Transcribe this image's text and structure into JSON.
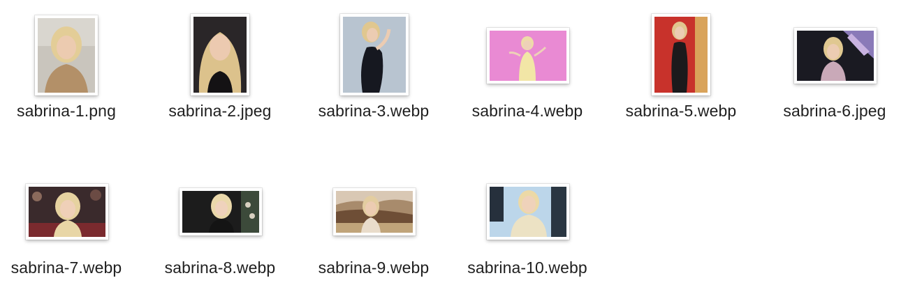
{
  "files": [
    {
      "name": "sabrina-1.png"
    },
    {
      "name": "sabrina-2.jpeg"
    },
    {
      "name": "sabrina-3.webp"
    },
    {
      "name": "sabrina-4.webp"
    },
    {
      "name": "sabrina-5.webp"
    },
    {
      "name": "sabrina-6.jpeg"
    },
    {
      "name": "sabrina-7.webp"
    },
    {
      "name": "sabrina-8.webp"
    },
    {
      "name": "sabrina-9.webp"
    },
    {
      "name": "sabrina-10.webp"
    }
  ],
  "colors": {
    "background": "#ffffff",
    "label_text": "#1f1f1f",
    "hair_blonde": "#e6d2a4",
    "skin": "#edcfb8"
  }
}
